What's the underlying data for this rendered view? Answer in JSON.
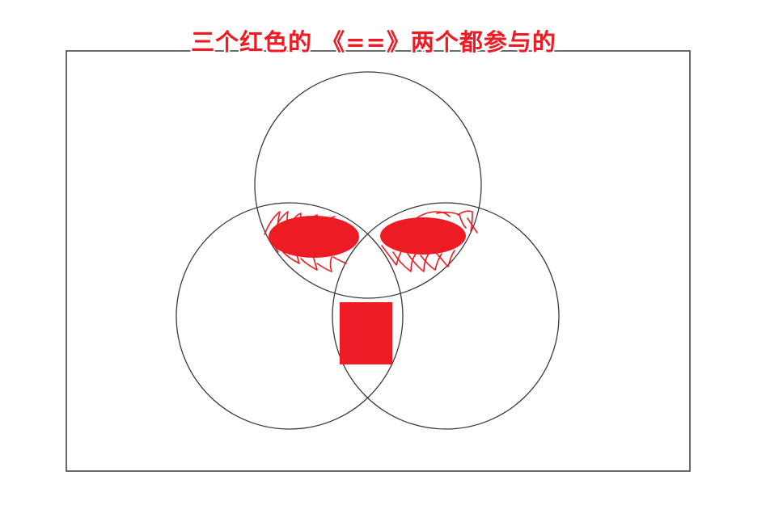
{
  "title": "三个红色的 《==》两个都参与的",
  "colors": {
    "annotation": "#ed1c24",
    "outline": "#3a3a3a",
    "background": "#ffffff"
  },
  "diagram": {
    "type": "venn",
    "set_count": 3,
    "highlighted_regions": [
      "top-left pairwise overlap",
      "top-right pairwise overlap",
      "bottom pairwise overlap"
    ]
  }
}
